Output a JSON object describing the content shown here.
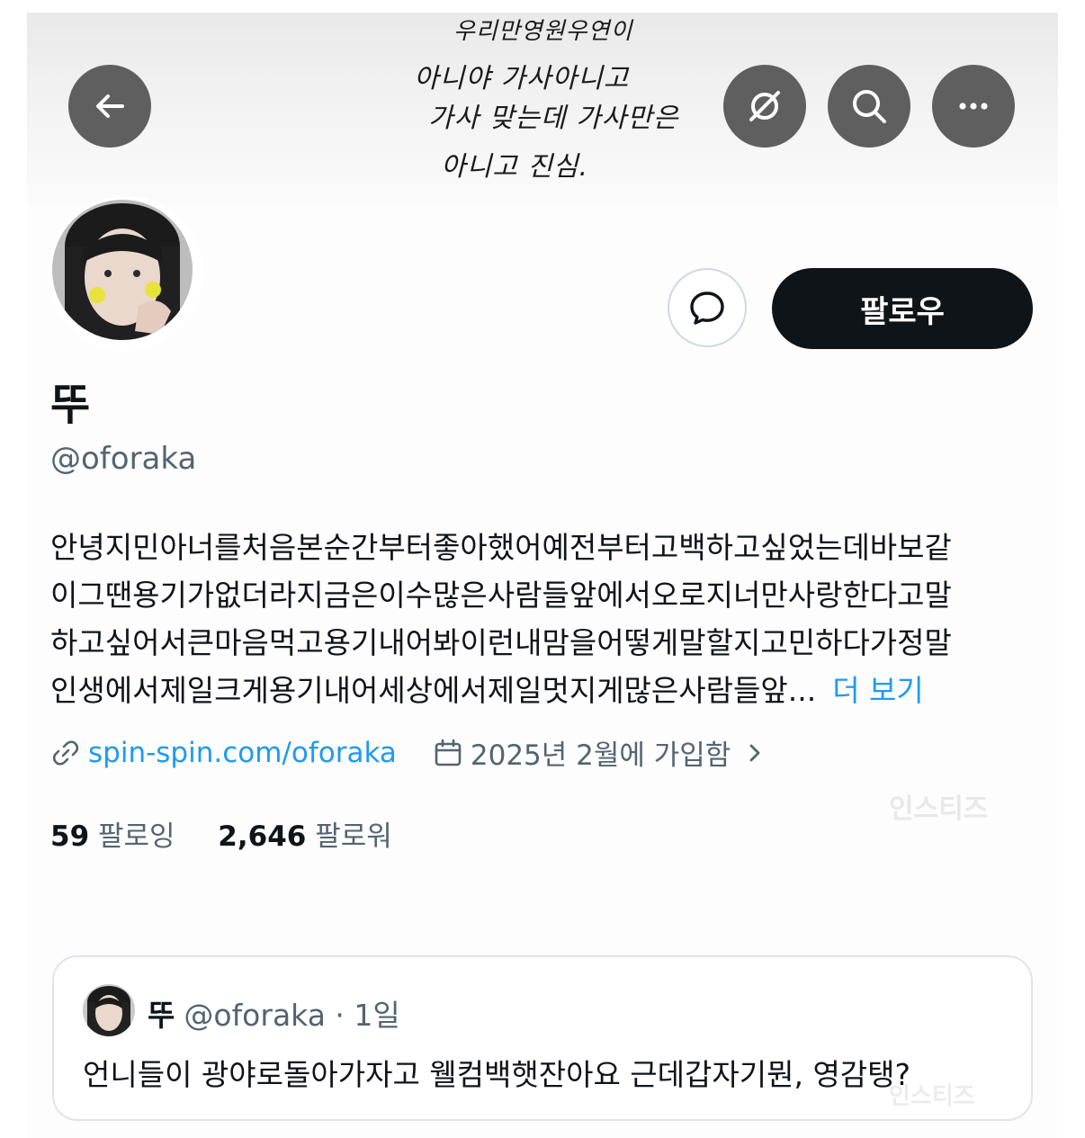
{
  "banner": {
    "handwriting_lines": [
      "우리만영원우연이",
      "아니야 가사아니고",
      "가사 맞는데 가사만은",
      "아니고 진심."
    ]
  },
  "icons": {
    "back": "arrow-left-icon",
    "grok": "grok-icon",
    "search": "search-icon",
    "more": "more-icon",
    "message": "message-icon",
    "link": "link-icon",
    "calendar": "calendar-icon",
    "chevron": "chevron-right-icon"
  },
  "profile": {
    "name": "뚜",
    "handle": "@oforaka",
    "follow_label": "팔로우",
    "bio_lines": [
      "안녕지민아너를처음본순간부터좋아했어예전부터고백하고싶었는데바보같",
      "이그땐용기가없더라지금은이수많은사람들앞에서오로지너만사랑한다고말",
      "하고싶어서큰마음먹고용기내어봐이런내맘을어떻게말할지고민하다가정말",
      "인생에서제일크게용기내어세상에서제일멋지게많은사람들앞..."
    ],
    "more_label": "더 보기",
    "link": "spin-spin.com/oforaka",
    "joined": "2025년 2월에 가입함",
    "following_count": "59",
    "following_label": "팔로잉",
    "followers_count": "2,646",
    "followers_label": "팔로워"
  },
  "watermark": "인스티즈",
  "quote": {
    "name": "뚜",
    "handle_time": "@oforaka · 1일",
    "text": "언니들이 광야로돌아가자고 웰컴백햇잔아요 근데갑자기뭔, 영감탱?"
  },
  "colors": {
    "accent": "#1d9bf0",
    "text": "#0f1419",
    "secondary": "#536471",
    "follow_bg": "#0f1419"
  }
}
